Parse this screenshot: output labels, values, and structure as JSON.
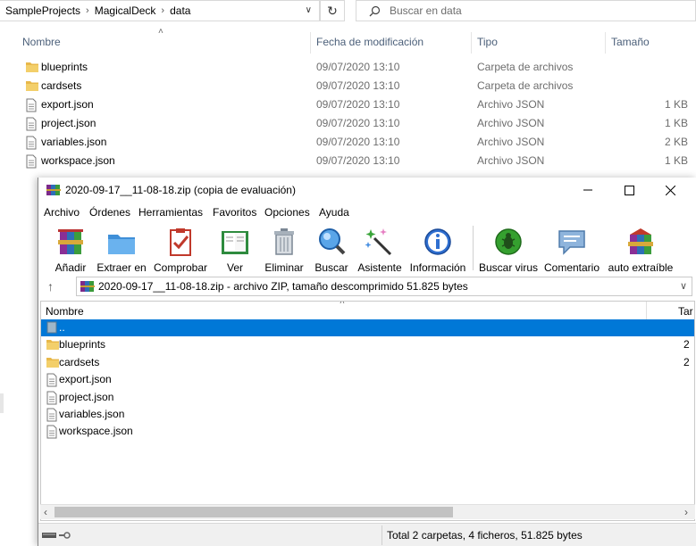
{
  "explorer": {
    "breadcrumbs": [
      "SampleProjects",
      "MagicalDeck",
      "data"
    ],
    "search_placeholder": "Buscar en data",
    "columns": {
      "name": "Nombre",
      "date": "Fecha de modificación",
      "type": "Tipo",
      "size": "Tamaño"
    },
    "rows": [
      {
        "name": "blueprints",
        "date": "09/07/2020 13:10",
        "type": "Carpeta de archivos",
        "size": "",
        "icon": "folder-icon"
      },
      {
        "name": "cardsets",
        "date": "09/07/2020 13:10",
        "type": "Carpeta de archivos",
        "size": "",
        "icon": "folder-icon"
      },
      {
        "name": "export.json",
        "date": "09/07/2020 13:10",
        "type": "Archivo JSON",
        "size": "1 KB",
        "icon": "file-icon"
      },
      {
        "name": "project.json",
        "date": "09/07/2020 13:10",
        "type": "Archivo JSON",
        "size": "1 KB",
        "icon": "file-icon"
      },
      {
        "name": "variables.json",
        "date": "09/07/2020 13:10",
        "type": "Archivo JSON",
        "size": "2 KB",
        "icon": "file-icon"
      },
      {
        "name": "workspace.json",
        "date": "09/07/2020 13:10",
        "type": "Archivo JSON",
        "size": "1 KB",
        "icon": "file-icon"
      }
    ]
  },
  "rar": {
    "title": "2020-09-17__11-08-18.zip (copia de evaluación)",
    "menu": [
      {
        "label": "Archivo"
      },
      {
        "label": "Órdenes"
      },
      {
        "label": "Herramientas"
      },
      {
        "label": "Favoritos"
      },
      {
        "label": "Opciones"
      },
      {
        "label": "Ayuda"
      }
    ],
    "toolbar": [
      {
        "label": "Añadir",
        "icon": "add-archive-icon"
      },
      {
        "label": "Extraer en",
        "icon": "extract-folder-icon"
      },
      {
        "label": "Comprobar",
        "icon": "test-clipboard-icon"
      },
      {
        "label": "Ver",
        "icon": "view-book-icon"
      },
      {
        "label": "Eliminar",
        "icon": "trash-icon"
      },
      {
        "label": "Buscar",
        "icon": "magnifier-icon"
      },
      {
        "label": "Asistente",
        "icon": "wizard-wand-icon"
      },
      {
        "label": "Información",
        "icon": "info-icon"
      },
      {
        "label": "Buscar virus",
        "icon": "virus-scan-icon"
      },
      {
        "label": "Comentario",
        "icon": "comment-icon"
      },
      {
        "label": "auto extraíble",
        "icon": "sfx-icon"
      }
    ],
    "path": "2020-09-17__11-08-18.zip - archivo ZIP, tamaño descomprimido 51.825 bytes",
    "list_header": {
      "name": "Nombre",
      "size": "Tar"
    },
    "rows": [
      {
        "name": "..",
        "size": "",
        "icon": "parent-folder-icon",
        "selected": true
      },
      {
        "name": "blueprints",
        "size": "2",
        "icon": "folder-icon"
      },
      {
        "name": "cardsets",
        "size": "2",
        "icon": "folder-icon"
      },
      {
        "name": "export.json",
        "size": "",
        "icon": "file-icon"
      },
      {
        "name": "project.json",
        "size": "",
        "icon": "file-icon"
      },
      {
        "name": "variables.json",
        "size": "",
        "icon": "file-icon"
      },
      {
        "name": "workspace.json",
        "size": "",
        "icon": "file-icon"
      }
    ],
    "status": "Total 2 carpetas, 4 ficheros, 51.825 bytes",
    "colors": {
      "selection": "#0078d7",
      "folder": "#e8b84a"
    }
  }
}
